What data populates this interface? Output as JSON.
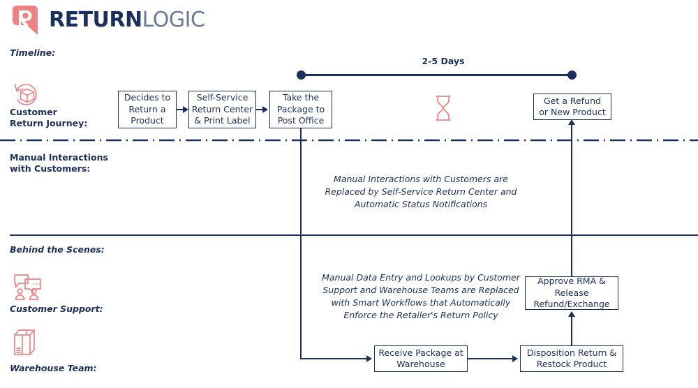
{
  "brand": {
    "logo_icon": "returnlogic-r-pin-logo",
    "name_bold": "RETURN",
    "name_light": "LOGIC",
    "navy": "#1b2f5e",
    "salmon": "#f08383"
  },
  "lanes": {
    "timeline": {
      "label": "Timeline:"
    },
    "customer_journey": {
      "label": "Customer\nReturn Journey:",
      "icon": "return-package-icon"
    },
    "manual_interactions": {
      "label": "Manual Interactions\nwith Customers:"
    },
    "behind_scenes": {
      "label": "Behind the Scenes:"
    },
    "customer_support": {
      "label": "Customer Support:",
      "icon": "chat-support-icon"
    },
    "warehouse_team": {
      "label": "Warehouse Team:",
      "icon": "warehouse-boxes-icon"
    }
  },
  "timeline": {
    "duration_label": "2-5 Days",
    "waiting_icon": "hourglass-icon"
  },
  "boxes": {
    "decides_to_return": "Decides to\nReturn a\nProduct",
    "self_service": "Self-Service\nReturn Center\n& Print Label",
    "take_package": "Take the\nPackage to\nPost Office",
    "get_refund": "Get a Refund\nor New Product",
    "approve_rma": "Approve RMA &\nRelease\nRefund/Exchange",
    "receive_package": "Receive Package at\nWarehouse",
    "disposition_return": "Disposition Return &\nRestock Product"
  },
  "callouts": {
    "manual_interactions": "Manual Interactions with Customers are\nReplaced by Self-Service Return Center and\nAutomatic Status Notifications",
    "manual_data_entry": "Manual Data Entry and Lookups by Customer\nSupport and Warehouse Teams are Replaced\nwith Smart Workflows that Automatically\nEnforce the Retailer's Return Policy"
  }
}
